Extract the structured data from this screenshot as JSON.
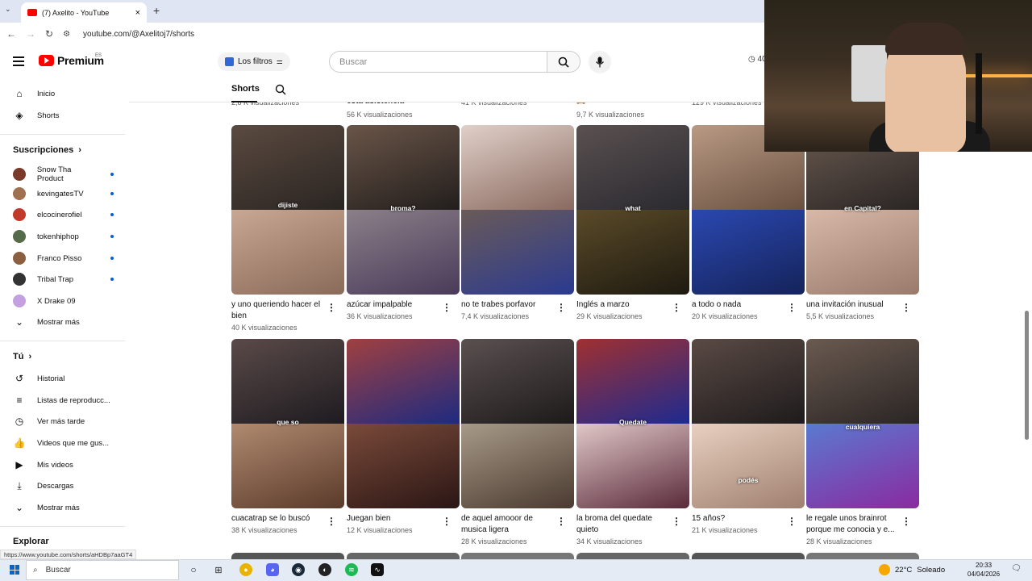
{
  "browser": {
    "tab_title": "(7) Axelito - YouTube",
    "url": "youtube.com/@Axelitoj7/shorts",
    "status_url": "https://www.youtube.com/shorts/aHDBp7aaGT4"
  },
  "masthead": {
    "brand": "Premium",
    "region": "ES",
    "filters_label": "Los filtros",
    "search_placeholder": "Buscar",
    "timer": "40"
  },
  "channel_tabs": {
    "active": "Shorts"
  },
  "sidebar": {
    "main": [
      {
        "label": "Inicio",
        "icon": "home-icon"
      },
      {
        "label": "Shorts",
        "icon": "shorts-icon"
      }
    ],
    "subs_title": "Suscripciones",
    "subs": [
      {
        "label": "Snow Tha Product",
        "color": "#7a3a2a"
      },
      {
        "label": "kevingatesTV",
        "color": "#a07050"
      },
      {
        "label": "elcocinerofiel",
        "color": "#c0392b"
      },
      {
        "label": "tokenhiphop",
        "color": "#556b4a"
      },
      {
        "label": "Franco Pisso",
        "color": "#8a6040"
      },
      {
        "label": "Tribal Trap",
        "color": "#333333"
      },
      {
        "label": "X Drake 09",
        "color": "#c4a0e0"
      }
    ],
    "more_subs": "Mostrar más",
    "you_title": "Tú",
    "you": [
      {
        "label": "Historial",
        "icon": "history-icon"
      },
      {
        "label": "Listas de reproducc...",
        "icon": "playlists-icon"
      },
      {
        "label": "Ver más tarde",
        "icon": "watch-later-icon"
      },
      {
        "label": "Videos que me gus...",
        "icon": "like-icon"
      },
      {
        "label": "Mis videos",
        "icon": "my-videos-icon"
      },
      {
        "label": "Descargas",
        "icon": "downloads-icon"
      }
    ],
    "more_you": "Mostrar más",
    "explore_title": "Explorar"
  },
  "partial_row": {
    "views": [
      "2,8 K visualizaciones",
      "56 K visualizaciones",
      "41 K visualizaciones",
      "9,7 K visualizaciones",
      "129 K visualizaciones"
    ],
    "titles": [
      "esta asistencia"
    ],
    "emoji_label": "🙈"
  },
  "rows": [
    [
      {
        "title": "y uno queriendo hacer el bien",
        "views": "40 K visualizaciones",
        "caption": "dijiste",
        "top": "#3a3430",
        "bot": "#b89a86"
      },
      {
        "title": "azúcar impalpable",
        "views": "36 K visualizaciones",
        "caption": "broma?",
        "top": "#2e2a28",
        "bot": "#6a5e6a"
      },
      {
        "title": "no te trabes porfavor",
        "views": "7,4 K visualizaciones",
        "caption": "",
        "top": "#b8a8a0",
        "bot": "#3b3560"
      },
      {
        "title": "Inglés a marzo",
        "views": "29 K visualizaciones",
        "caption": "what",
        "top": "#3a3a40",
        "bot": "#4a3a20"
      },
      {
        "title": "a todo o nada",
        "views": "20 K visualizaciones",
        "caption": "",
        "top": "#a88a70",
        "bot": "#2440a0"
      },
      {
        "title": "una invitación inusual",
        "views": "5,5 K visualizaciones",
        "caption": "en Capital?",
        "top": "#4a4440",
        "bot": "#c0a090"
      }
    ],
    [
      {
        "title": "cuacatrap se lo buscó",
        "views": "38 K visualizaciones",
        "caption": "que so",
        "top": "#2e2a30",
        "bot": "#8a6a58"
      },
      {
        "title": "Juegan bien",
        "views": "12 K visualizaciones",
        "caption": "",
        "top": "#283890",
        "bot": "#5a3830"
      },
      {
        "title": "de aquel amooor de musica ligera",
        "views": "28 K visualizaciones",
        "caption": "",
        "top": "#2e2a28",
        "bot": "#8a8070"
      },
      {
        "title": "la broma del quedate quieto",
        "views": "34 K visualizaciones",
        "caption": "Quedate",
        "top": "#2a3aa0",
        "bot": "#c0a8a8"
      },
      {
        "title": "15 años?",
        "views": "21 K visualizaciones",
        "caption": "podés",
        "top": "#3a3430",
        "bot": "#d8b8a0"
      },
      {
        "title": "le regale unos brainrot porque me conocia y e...",
        "views": "28 K visualizaciones",
        "caption": "cualquiera",
        "top": "#403a38",
        "bot": "#4a6ab0"
      }
    ]
  ],
  "taskbar": {
    "search": "Buscar",
    "temp": "22°C",
    "weather": "Soleado",
    "time": "20:33",
    "date": "04/04/2026"
  }
}
